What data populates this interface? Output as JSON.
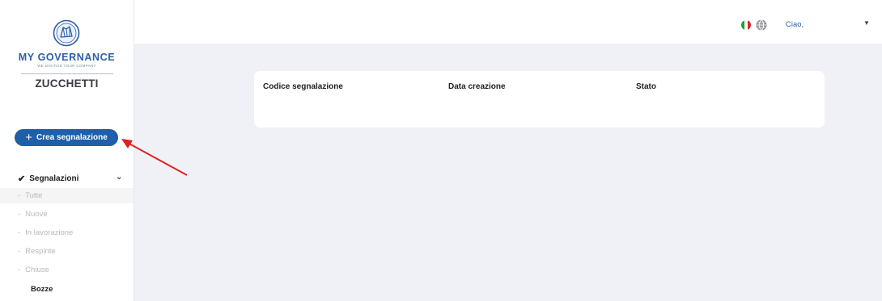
{
  "brand": {
    "name": "MY GOVERNANCE",
    "tagline": "WE DIGITIZE YOUR COMPANY",
    "company": "ZUCCHETTI",
    "color": "#2a5fa8",
    "emblem_icon": "governance-logo-icon"
  },
  "sidebar": {
    "create_button": {
      "label": "Crea segnalazione",
      "icon": "plus-icon",
      "color": "#1f5ea8"
    },
    "group": {
      "label": "Segnalazioni",
      "icon": "check-icon",
      "expand_icon": "chevron-down-icon"
    },
    "items": [
      {
        "label": "Tutte",
        "active": true
      },
      {
        "label": "Nuove"
      },
      {
        "label": "In lavorazione"
      },
      {
        "label": "Respinte"
      },
      {
        "label": "Chiuse"
      }
    ],
    "drafts_label": "Bozze"
  },
  "header": {
    "language_icon": "italy-flag-icon",
    "globe_icon": "globe-icon",
    "greeting": "Ciao,",
    "user_menu_icon": "caret-down-icon"
  },
  "table": {
    "columns": [
      "Codice segnalazione",
      "Data creazione",
      "Stato"
    ]
  },
  "annotation": {
    "icon": "red-arrow-icon",
    "color": "#e02020"
  }
}
